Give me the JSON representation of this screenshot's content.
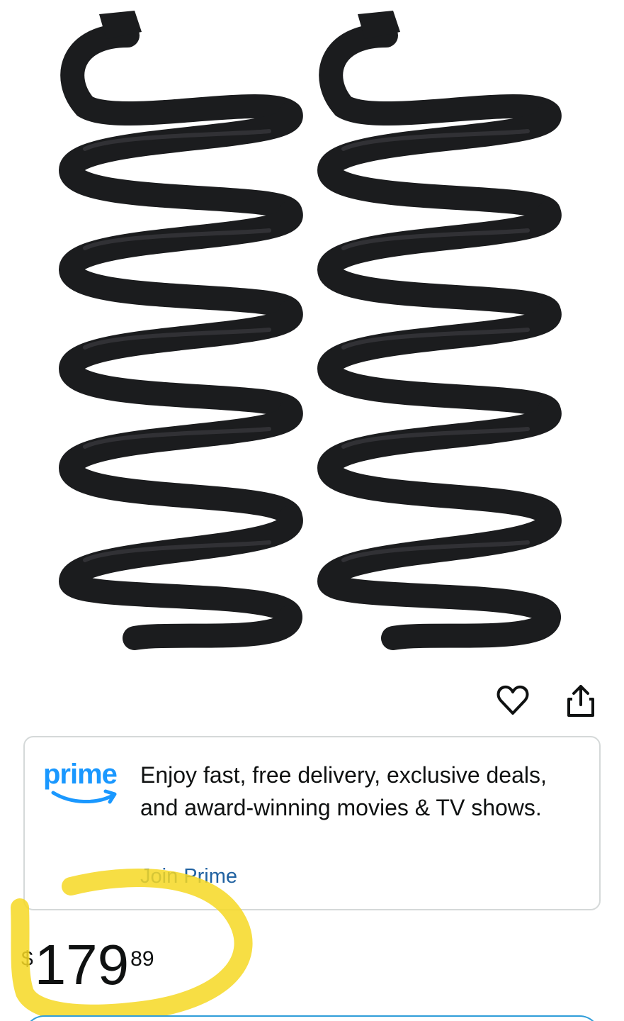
{
  "product": {
    "image_alt": "Pair of black coil springs"
  },
  "actions": {
    "wishlist_icon": "heart-outline-icon",
    "share_icon": "share-icon"
  },
  "prime_card": {
    "logo_text": "prime",
    "description": "Enjoy fast, free delivery, exclusive deals, and award-winning movies & TV shows.",
    "join_label": "Join Prime",
    "brand_color": "#1a98ff",
    "link_color": "#2162a1"
  },
  "price": {
    "symbol": "$",
    "whole": "179",
    "fraction": "89"
  },
  "annotation": {
    "highlight_color": "#f6d823"
  }
}
